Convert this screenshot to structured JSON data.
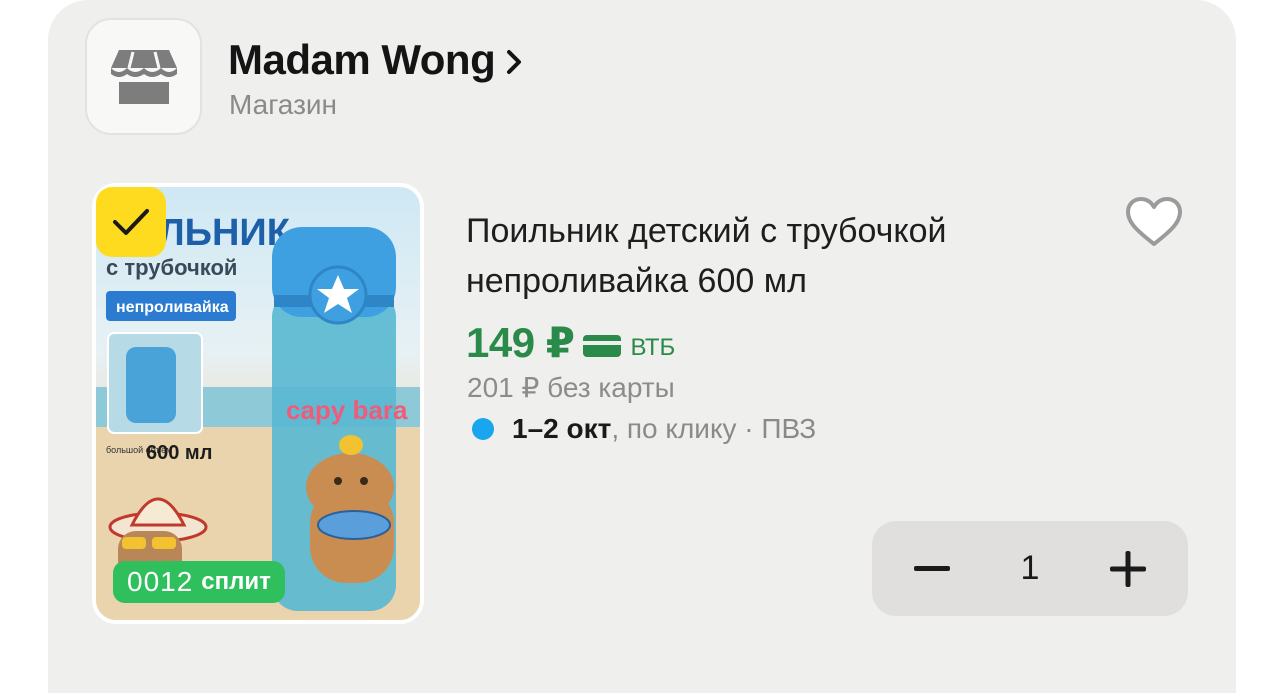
{
  "shop": {
    "name": "Madam Wong",
    "type": "Магазин",
    "logo_icon": "storefront-icon"
  },
  "product": {
    "title": "Поильник детский с трубочкой непроливайка 600 мл",
    "selected": true,
    "image": {
      "headline": "ЛЬНИК",
      "subline": "с трубочкой",
      "tag": "непроливайка",
      "volume_small": "большой объем",
      "volume": "600 мл",
      "bottle_text": "capy bara"
    },
    "split": {
      "amount": "0012",
      "label": "сплит"
    },
    "price": "149 ₽",
    "bank": "ВТБ",
    "old_price": "201 ₽ без карты",
    "delivery": {
      "date": "1–2 окт",
      "note": ", по клику · ПВЗ"
    },
    "quantity": "1"
  },
  "colors": {
    "price_green": "#2a8a4a",
    "check_yellow": "#ffdb1f",
    "split_green": "#2fbf5c",
    "delivery_dot": "#1aa6ee",
    "card_bg": "#efefee"
  },
  "icons": [
    "storefront-icon",
    "chevron-right-icon",
    "checkmark-icon",
    "heart-icon",
    "bank-card-icon",
    "minus-icon",
    "plus-icon"
  ]
}
